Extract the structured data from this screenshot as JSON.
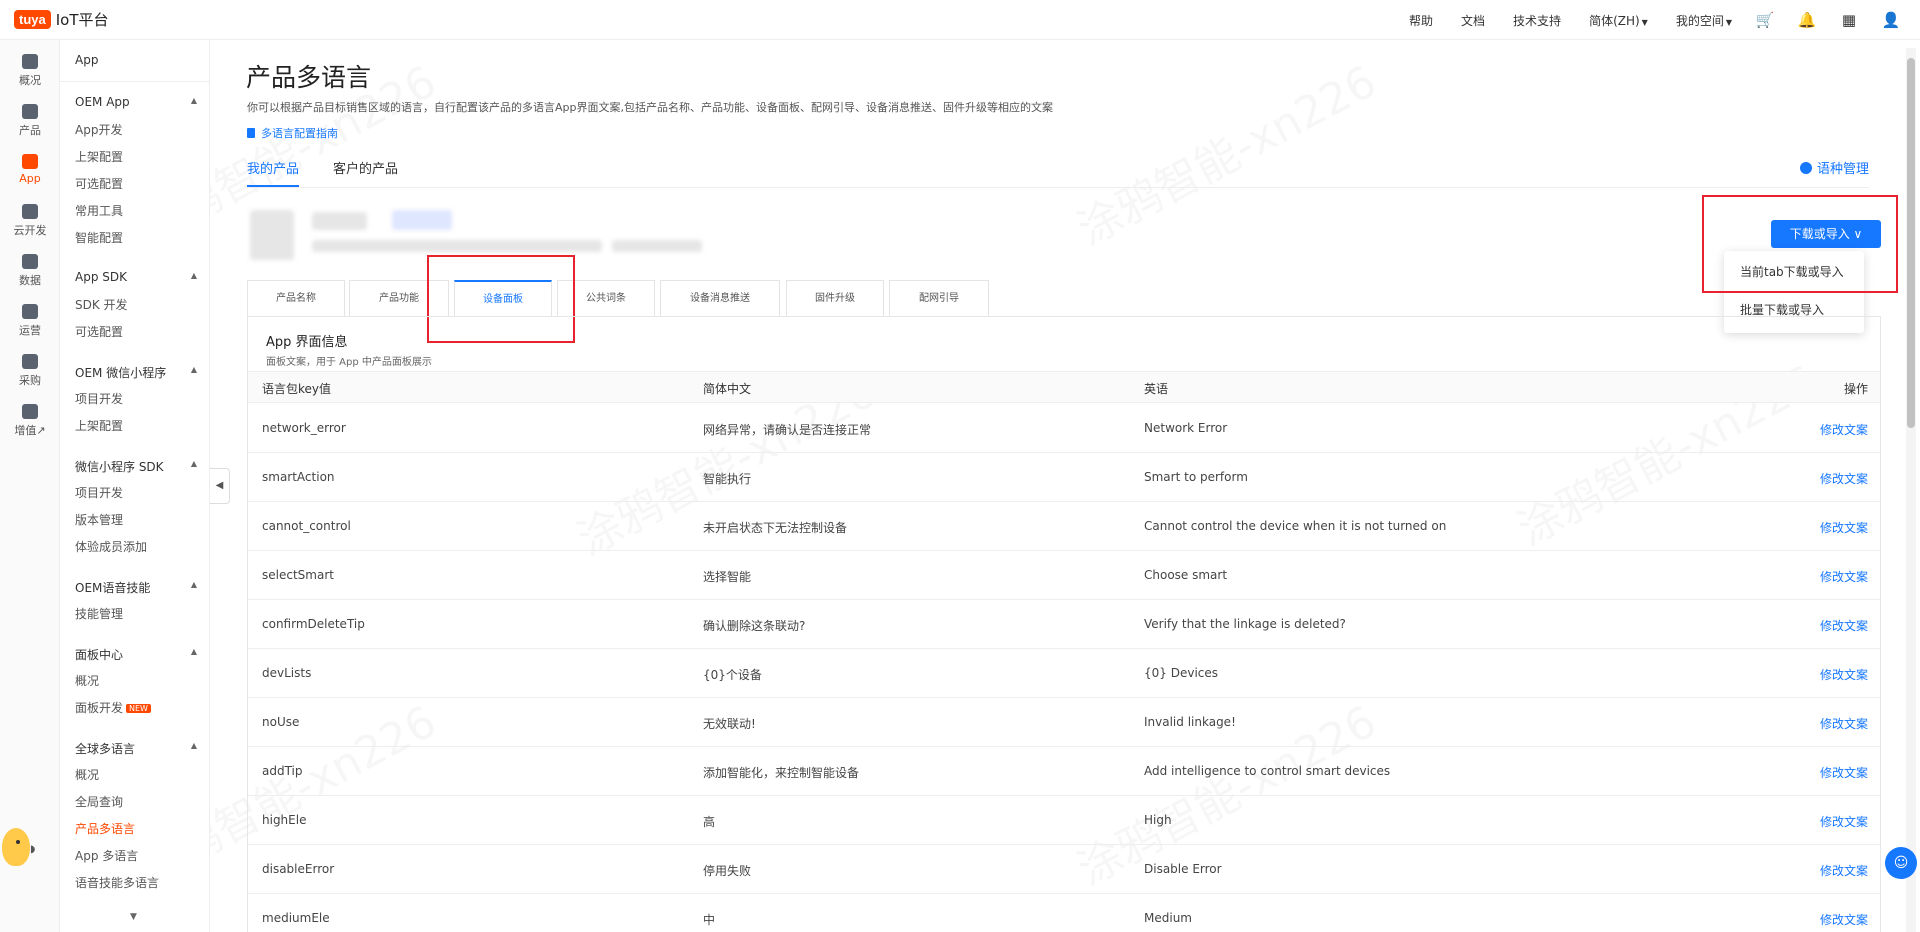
{
  "topbar": {
    "logo_badge": "tuya",
    "logo_text": "IoT平台",
    "nav": [
      "帮助",
      "文档",
      "技术支持"
    ],
    "language": "简体(ZH)",
    "space": "我的空间"
  },
  "rail": [
    "概况",
    "产品",
    "App",
    "云开发",
    "数据",
    "运营",
    "采购",
    "增值↗"
  ],
  "sidebar": {
    "head": "App",
    "groups": [
      {
        "label": "OEM App",
        "items": [
          "App开发",
          "上架配置",
          "可选配置",
          "常用工具",
          "智能配置"
        ]
      },
      {
        "label": "App SDK",
        "items": [
          "SDK 开发",
          "可选配置"
        ]
      },
      {
        "label": "OEM 微信小程序",
        "items": [
          "项目开发",
          "上架配置"
        ]
      },
      {
        "label": "微信小程序 SDK",
        "items": [
          "项目开发",
          "版本管理",
          "体验成员添加"
        ]
      },
      {
        "label": "OEM语音技能",
        "items": [
          "技能管理"
        ]
      },
      {
        "label": "面板中心",
        "items": [
          "概况",
          "面板开发"
        ]
      },
      {
        "label": "全球多语言",
        "items": [
          "概况",
          "全局查询",
          "产品多语言",
          "App 多语言",
          "语音技能多语言"
        ]
      }
    ],
    "new_badge": "NEW"
  },
  "main": {
    "title": "产品多语言",
    "description": "你可以根据产品目标销售区域的语言，自行配置该产品的多语言App界面文案,包括产品名称、产品功能、设备面板、配网引导、设备消息推送、固件升级等相应的文案",
    "guide_link": "多语言配置指南",
    "tabs": [
      "我的产品",
      "客户的产品"
    ],
    "lang_mgmt": "语种管理",
    "download_btn": "下载或导入 ∨",
    "dropdown": [
      "当前tab下载或导入",
      "批量下载或导入"
    ],
    "panel_tabs": [
      "产品名称",
      "产品功能",
      "设备面板",
      "公共词条",
      "设备消息推送",
      "固件升级",
      "配网引导"
    ],
    "panel_title": "App 界面信息",
    "panel_subtitle": "面板文案，用于 App 中产品面板展示",
    "columns": [
      "语言包key值",
      "简体中文",
      "英语",
      "操作"
    ],
    "rows": [
      {
        "key": "network_error",
        "zh": "网络异常，请确认是否连接正常",
        "en": "Network Error",
        "op": "修改文案"
      },
      {
        "key": "smartAction",
        "zh": "智能执行",
        "en": "Smart to perform",
        "op": "修改文案"
      },
      {
        "key": "cannot_control",
        "zh": "未开启状态下无法控制设备",
        "en": "Cannot control the device when it is not turned on",
        "op": "修改文案"
      },
      {
        "key": "selectSmart",
        "zh": "选择智能",
        "en": "Choose smart",
        "op": "修改文案"
      },
      {
        "key": "confirmDeleteTip",
        "zh": "确认删除这条联动?",
        "en": "Verify that the linkage is deleted?",
        "op": "修改文案"
      },
      {
        "key": "devLists",
        "zh": "{0}个设备",
        "en": "{0} Devices",
        "op": "修改文案"
      },
      {
        "key": "noUse",
        "zh": "无效联动!",
        "en": "Invalid linkage!",
        "op": "修改文案"
      },
      {
        "key": "addTip",
        "zh": "添加智能化，来控制智能设备",
        "en": "Add intelligence to control smart devices",
        "op": "修改文案"
      },
      {
        "key": "highEle",
        "zh": "高",
        "en": "High",
        "op": "修改文案"
      },
      {
        "key": "disableError",
        "zh": "停用失败",
        "en": "Disable Error",
        "op": "修改文案"
      },
      {
        "key": "mediumEle",
        "zh": "中",
        "en": "Medium",
        "op": "修改文案"
      }
    ]
  },
  "watermark": "涂鸦智能-xn226",
  "colors": {
    "accent": "#1677ff",
    "brand": "#ff4800",
    "highlight": "#e8232e"
  }
}
